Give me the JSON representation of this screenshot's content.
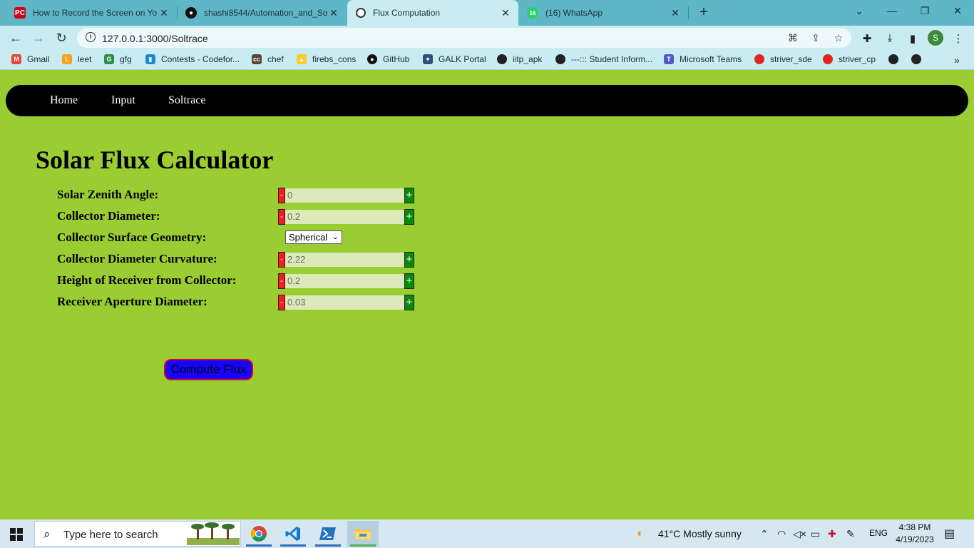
{
  "browser": {
    "tabs": [
      {
        "label": "How to Record the Screen on Yo",
        "icon": "pc-mag-icon",
        "color": "#d0021b",
        "active": false
      },
      {
        "label": "shashi8544/Automation_and_Sol",
        "icon": "github-icon",
        "active": false
      },
      {
        "label": "Flux Computation",
        "icon": "globe-icon",
        "active": true
      },
      {
        "label": "(16) WhatsApp",
        "icon": "whatsapp-icon",
        "color": "#25d366",
        "badge": "16",
        "active": false
      }
    ],
    "url": "127.0.0.1:3000/Soltrace",
    "profile_initial": "S",
    "bookmarks": [
      {
        "label": "Gmail",
        "icon": "gmail-icon",
        "color": "#ea4335"
      },
      {
        "label": "leet",
        "icon": "leetcode-icon",
        "color": "#f89f1b"
      },
      {
        "label": "gfg",
        "icon": "gfg-icon",
        "color": "#2f8d46"
      },
      {
        "label": "Contests - Codefor...",
        "icon": "codeforces-icon",
        "color": "#1f8acb"
      },
      {
        "label": "chef",
        "icon": "codechef-icon",
        "color": "#5b4638"
      },
      {
        "label": "firebs_cons",
        "icon": "firebase-icon",
        "color": "#ffca28"
      },
      {
        "label": "GitHub",
        "icon": "github-icon",
        "color": "#111111"
      },
      {
        "label": "GALK Portal",
        "icon": "galk-icon",
        "color": "#2d4f7a"
      },
      {
        "label": "iitp_apk",
        "icon": "globe-icon",
        "color": "#222222"
      },
      {
        "label": "---::: Student Inform...",
        "icon": "globe-icon",
        "color": "#222222"
      },
      {
        "label": "Microsoft Teams",
        "icon": "teams-icon",
        "color": "#5059c9"
      },
      {
        "label": "striver_sde",
        "icon": "tuf-icon",
        "color": "#e02424"
      },
      {
        "label": "striver_cp",
        "icon": "tuf-icon",
        "color": "#e02424"
      }
    ]
  },
  "site": {
    "nav": [
      "Home",
      "Input",
      "Soltrace"
    ],
    "heading": "Solar Flux Calculator",
    "fields": [
      {
        "label": "Solar Zenith Angle:",
        "value": "0"
      },
      {
        "label": "Collector Diameter:",
        "value": "0.2"
      },
      {
        "label": "Collector Surface Geometry:",
        "select": "Spherical"
      },
      {
        "label": "Collector Diameter Curvature:",
        "value": "2.22"
      },
      {
        "label": "Height of Receiver from Collector:",
        "value": "0.2"
      },
      {
        "label": "Receiver Aperture Diameter:",
        "value": "0.03"
      }
    ],
    "compute_label": "Compute Flux"
  },
  "taskbar": {
    "search_placeholder": "Type here to search",
    "weather": "41°C  Mostly sunny",
    "lang": "ENG",
    "time": "4:38 PM",
    "date": "4/19/2023"
  },
  "colors": {
    "page_bg": "#9acd32",
    "navbar_bg": "#000000",
    "minus": "#ff1a1a",
    "plus": "#0a8a0a",
    "compute_bg": "#1a00ff",
    "compute_border": "#e0001e"
  }
}
